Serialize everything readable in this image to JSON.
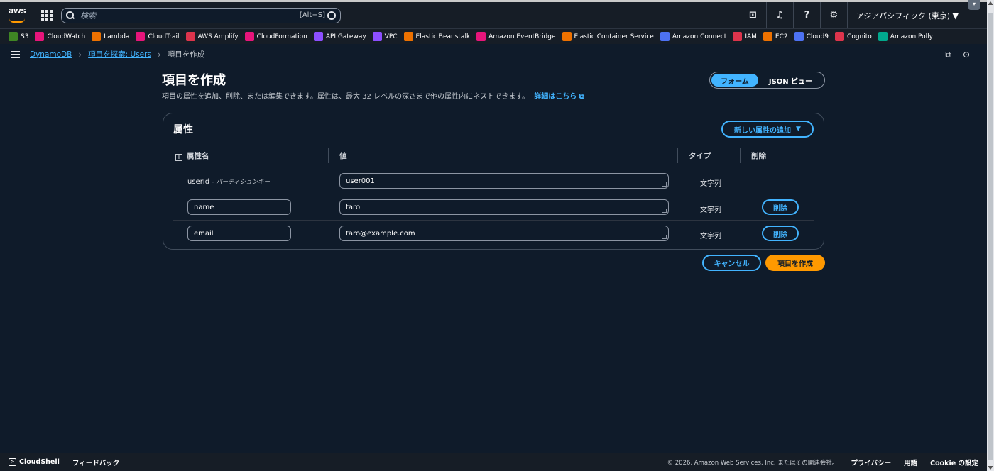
{
  "topnav": {
    "logo": "aws",
    "search_placeholder": "検索",
    "search_shortcut": "[Alt+S]",
    "region": "アジアパシフィック (東京) ▼",
    "icons": [
      "cloudshell-icon",
      "bell-icon",
      "help-icon",
      "gear-icon"
    ]
  },
  "favorites": [
    {
      "label": "S3",
      "color": "#3f8624"
    },
    {
      "label": "CloudWatch",
      "color": "#e7157b"
    },
    {
      "label": "Lambda",
      "color": "#ed7100"
    },
    {
      "label": "CloudTrail",
      "color": "#e7157b"
    },
    {
      "label": "AWS Amplify",
      "color": "#dd344c"
    },
    {
      "label": "CloudFormation",
      "color": "#e7157b"
    },
    {
      "label": "API Gateway",
      "color": "#8c4fff"
    },
    {
      "label": "VPC",
      "color": "#8c4fff"
    },
    {
      "label": "Elastic Beanstalk",
      "color": "#ed7100"
    },
    {
      "label": "Amazon EventBridge",
      "color": "#e7157b"
    },
    {
      "label": "Elastic Container Service",
      "color": "#ed7100"
    },
    {
      "label": "Amazon Connect",
      "color": "#4d72f3"
    },
    {
      "label": "IAM",
      "color": "#dd344c"
    },
    {
      "label": "EC2",
      "color": "#ed7100"
    },
    {
      "label": "Cloud9",
      "color": "#4d72f3"
    },
    {
      "label": "Cognito",
      "color": "#dd344c"
    },
    {
      "label": "Amazon Polly",
      "color": "#01a88d"
    }
  ],
  "breadcrumb": {
    "items": [
      "DynamoDB",
      "項目を探索: Users"
    ],
    "current": "項目を作成"
  },
  "page": {
    "title": "項目を作成",
    "description": "項目の属性を追加、削除、または編集できます。属性は、最大 32 レベルの深さまで他の属性内にネストできます。",
    "more_link": "詳細はこちら",
    "view_toggle": {
      "form": "フォーム",
      "json": "JSON ビュー"
    }
  },
  "attributes": {
    "title": "属性",
    "add_button": "新しい属性の追加",
    "columns": {
      "name": "属性名",
      "value": "値",
      "type": "タイプ",
      "delete": "削除"
    },
    "rows": [
      {
        "name": "userId",
        "name_note": "- パーティションキー",
        "value": "user001",
        "type": "文字列",
        "deletable": false
      },
      {
        "name": "name",
        "value": "taro",
        "type": "文字列",
        "delete_label": "削除",
        "deletable": true
      },
      {
        "name": "email",
        "value": "taro@example.com",
        "type": "文字列",
        "delete_label": "削除",
        "deletable": true
      }
    ]
  },
  "actions": {
    "cancel": "キャンセル",
    "create": "項目を作成"
  },
  "footer": {
    "cloudshell": "CloudShell",
    "feedback": "フィードバック",
    "copyright": "© 2026, Amazon Web Services, Inc. またはその関連会社。",
    "privacy": "プライバシー",
    "terms": "用語",
    "cookie": "Cookie の設定"
  }
}
